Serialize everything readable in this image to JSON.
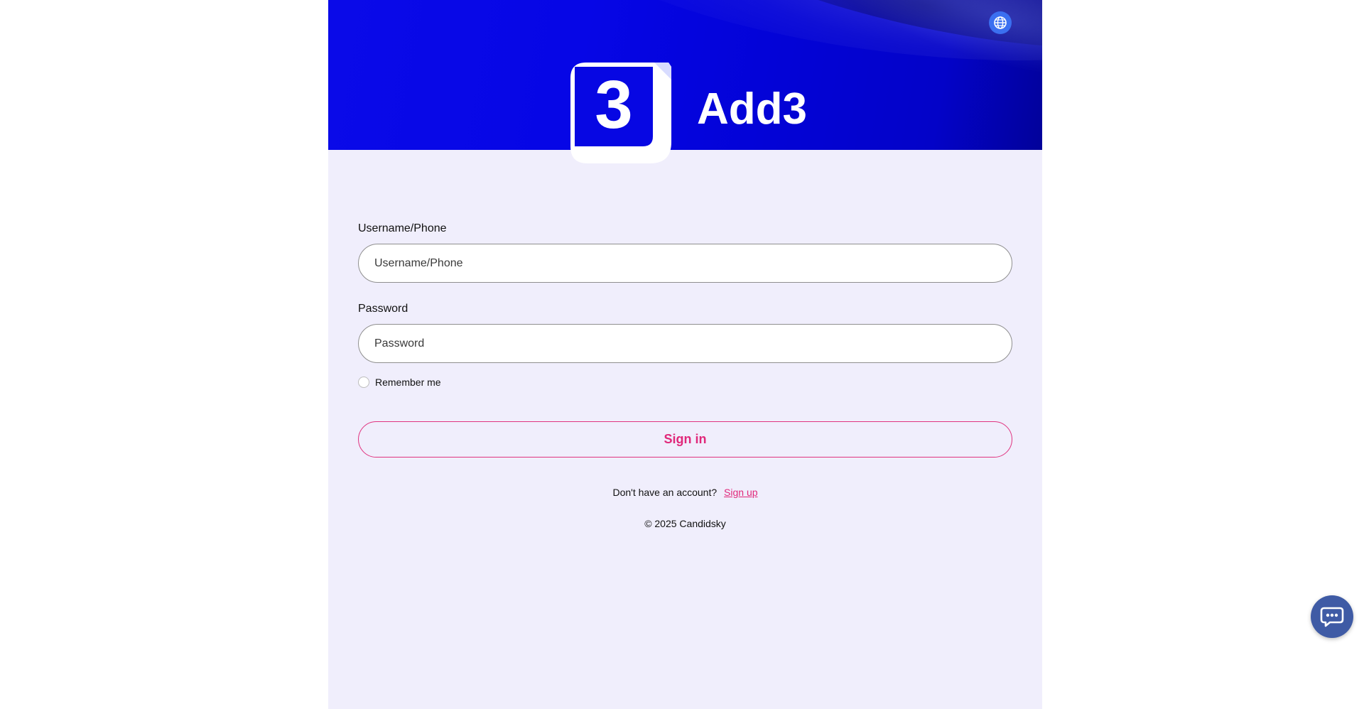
{
  "brand": {
    "name": "Add3"
  },
  "header": {
    "language_icon": "globe-icon"
  },
  "login_form": {
    "username_label": "Username/Phone",
    "username_placeholder": "Username/Phone",
    "username_value": "",
    "password_label": "Password",
    "password_placeholder": "Password",
    "password_value": "",
    "remember_label": "Remember me",
    "remember_checked": false,
    "signin_label": "Sign in",
    "no_account_text": "Don't have an account?",
    "signup_label": "Sign up"
  },
  "footer": {
    "copyright": "© 2025 Candidsky"
  },
  "chat_widget": {
    "icon": "chat-bubble-icon"
  },
  "colors": {
    "banner_blue": "#0606e6",
    "page_background": "#f0eefc",
    "accent_pink": "#e0287a",
    "language_button": "#3b6ff0",
    "chat_button": "#3f5ba5"
  }
}
